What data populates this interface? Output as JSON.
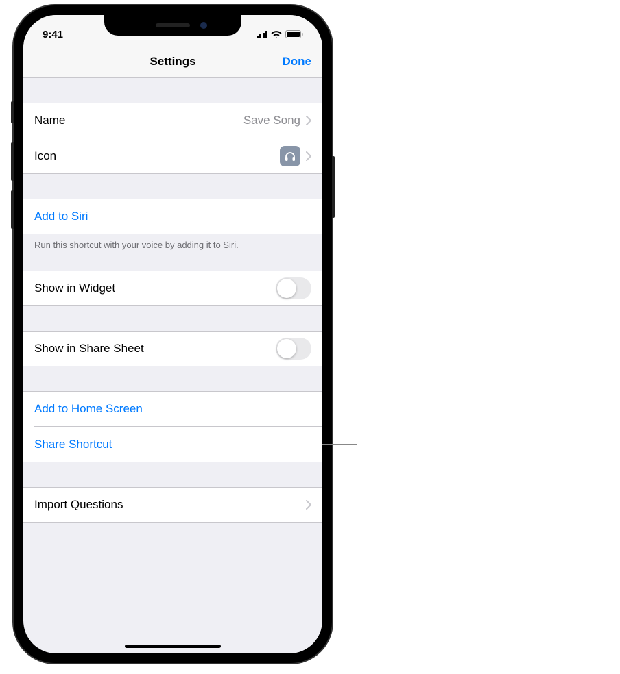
{
  "status": {
    "time": "9:41"
  },
  "nav": {
    "title": "Settings",
    "done": "Done"
  },
  "rows": {
    "name_label": "Name",
    "name_value": "Save Song",
    "icon_label": "Icon",
    "siri_label": "Add to Siri",
    "siri_footer": "Run this shortcut with your voice by adding it to Siri.",
    "widget_label": "Show in Widget",
    "share_sheet_label": "Show in Share Sheet",
    "home_screen_label": "Add to Home Screen",
    "share_shortcut_label": "Share Shortcut",
    "import_label": "Import Questions"
  }
}
